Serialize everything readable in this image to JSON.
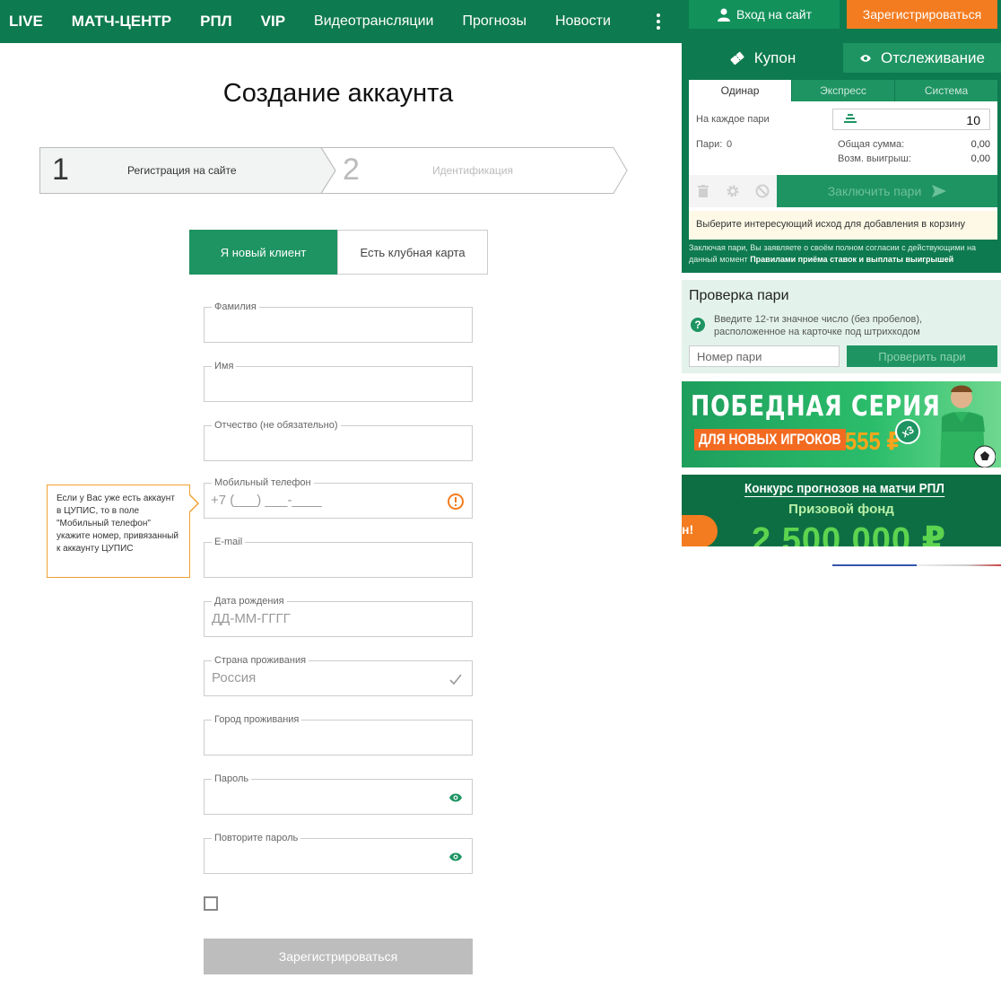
{
  "nav": {
    "items": [
      "LIVE",
      "МАТЧ-ЦЕНТР",
      "РПЛ",
      "VIP",
      "Видеотрансляции",
      "Прогнозы",
      "Новости"
    ],
    "more_icon": "vertical-dots-icon"
  },
  "auth": {
    "login_label": "Вход на сайт",
    "register_label": "Зарегистрироваться"
  },
  "page": {
    "title": "Создание аккаунта"
  },
  "steps": [
    {
      "number": "1",
      "label": "Регистрация на сайте"
    },
    {
      "number": "2",
      "label": "Идентификация"
    }
  ],
  "client_tabs": {
    "new_client": "Я новый клиент",
    "club_card": "Есть клубная карта"
  },
  "form": {
    "last_name_label": "Фамилия",
    "first_name_label": "Имя",
    "patronymic_label": "Отчество  (не обязательно)",
    "phone_label": "Мобильный телефон",
    "phone_placeholder": "+7 (___) ___-____",
    "email_label": "E-mail",
    "birthdate_label": "Дата рождения",
    "birthdate_placeholder": "ДД-ММ-ГГГГ",
    "country_label": "Страна проживания",
    "country_value": "Россия",
    "city_label": "Город проживания",
    "password_label": "Пароль",
    "repeat_password_label": "Повторите пароль",
    "submit_label": "Зарегистрироваться"
  },
  "tooltip": {
    "text": "Если у Вас уже есть аккаунт в ЦУПИС, то в поле \"Мобильный телефон\" укажите номер, привязанный к аккаунту ЦУПИС"
  },
  "coupon": {
    "tab_coupon": "Купон",
    "tab_tracking": "Отслеживание",
    "subtabs": [
      "Одинар",
      "Экспресс",
      "Система"
    ],
    "per_bet_label": "На каждое пари",
    "stake_value": "10",
    "bets_count_label": "Пари:",
    "bets_count": "0",
    "total_label": "Общая сумма:",
    "total_value": "0,00",
    "win_label": "Возм. выигрыш:",
    "win_value": "0,00",
    "place_bet_label": "Заключить пари",
    "hint": "Выберите интересующий исход для добавления в корзину",
    "terms_prefix": "Заключая пари, Вы заявляете о своём полном согласии с действующими на данный момент",
    "terms_link": "Правилами приёма ставок и выплаты выигрышей"
  },
  "bet_check": {
    "title": "Проверка пари",
    "description": "Введите 12-ти значное число (без пробелов), расположенное на карточке под штрихкодом",
    "input_placeholder": "Номер пари",
    "button_label": "Проверить пари",
    "help_icon": "?"
  },
  "banner1": {
    "title": "ПОБЕДНАЯ СЕРИЯ",
    "subtitle": "ДЛЯ НОВЫХ ИГРОКОВ",
    "amount": "555 ₽",
    "multiplier": "x3"
  },
  "banner2": {
    "title": "Конкурс прогнозов на матчи РПЛ",
    "subtitle": "Призовой фонд",
    "amount": "2 500 000 ₽",
    "tag": "н!"
  },
  "colors": {
    "brand_green": "#0e7a4f",
    "accent_green": "#1e9462",
    "orange": "#f47c20"
  }
}
